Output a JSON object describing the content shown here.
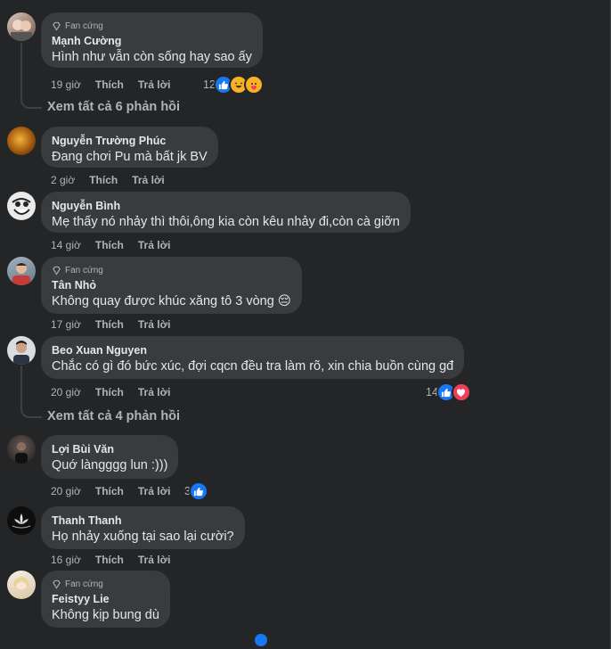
{
  "fan_badge": "Fan cứng",
  "comments": [
    {
      "name": "Mạnh Cường",
      "fan": true,
      "text": "Hình như vẫn còn sống hay sao ấy",
      "time": "19 giờ",
      "like": "Thích",
      "reply": "Trả lời",
      "reactions": {
        "count": "12",
        "icons": [
          "like-icon",
          "haha-icon",
          "care-icon"
        ]
      }
    },
    {
      "name": "Nguyễn Trường Phúc",
      "fan": false,
      "text": "Đang chơi Pu mà bất jk BV",
      "time": "2 giờ",
      "like": "Thích",
      "reply": "Trả lời"
    },
    {
      "name": "Nguyễn Bình",
      "fan": false,
      "text": "Mẹ thấy nó nhảy thì thôi,ông kia còn kêu nhảy đi,còn cà giỡn",
      "time": "14 giờ",
      "like": "Thích",
      "reply": "Trả lời"
    },
    {
      "name": "Tân Nhỏ",
      "fan": true,
      "text": "Không quay được khúc xăng tô 3 vòng 😔",
      "time": "17 giờ",
      "like": "Thích",
      "reply": "Trả lời"
    },
    {
      "name": "Beo Xuan Nguyen",
      "fan": false,
      "text": "Chắc có gì đó bức xúc, đợi cqcn đều tra làm rõ, xin chia buồn cùng gđ",
      "time": "20 giờ",
      "like": "Thích",
      "reply": "Trả lời",
      "reactions": {
        "count": "14",
        "icons": [
          "like-icon",
          "love-icon"
        ]
      }
    },
    {
      "name": "Lợi Bùi Văn",
      "fan": false,
      "text": "Quớ làngggg lun :)))",
      "time": "20 giờ",
      "like": "Thích",
      "reply": "Trả lời",
      "reactions": {
        "count": "3",
        "icons": [
          "like-icon"
        ]
      }
    },
    {
      "name": "Thanh Thanh",
      "fan": false,
      "text": "Họ nhảy xuống tại sao lại cười?",
      "time": "16 giờ",
      "like": "Thích",
      "reply": "Trả lời"
    },
    {
      "name": "Feistyy Lie",
      "fan": true,
      "text": "Không kịp bung dù"
    }
  ],
  "view_replies": [
    "Xem tất cả 6 phản hồi",
    "Xem tất cả 4 phản hồi"
  ],
  "colors": {
    "background": "#242526",
    "bubble": "#3a3b3c",
    "like": "#1877f2",
    "love": "#f33e58",
    "haha": "#f7b125"
  }
}
